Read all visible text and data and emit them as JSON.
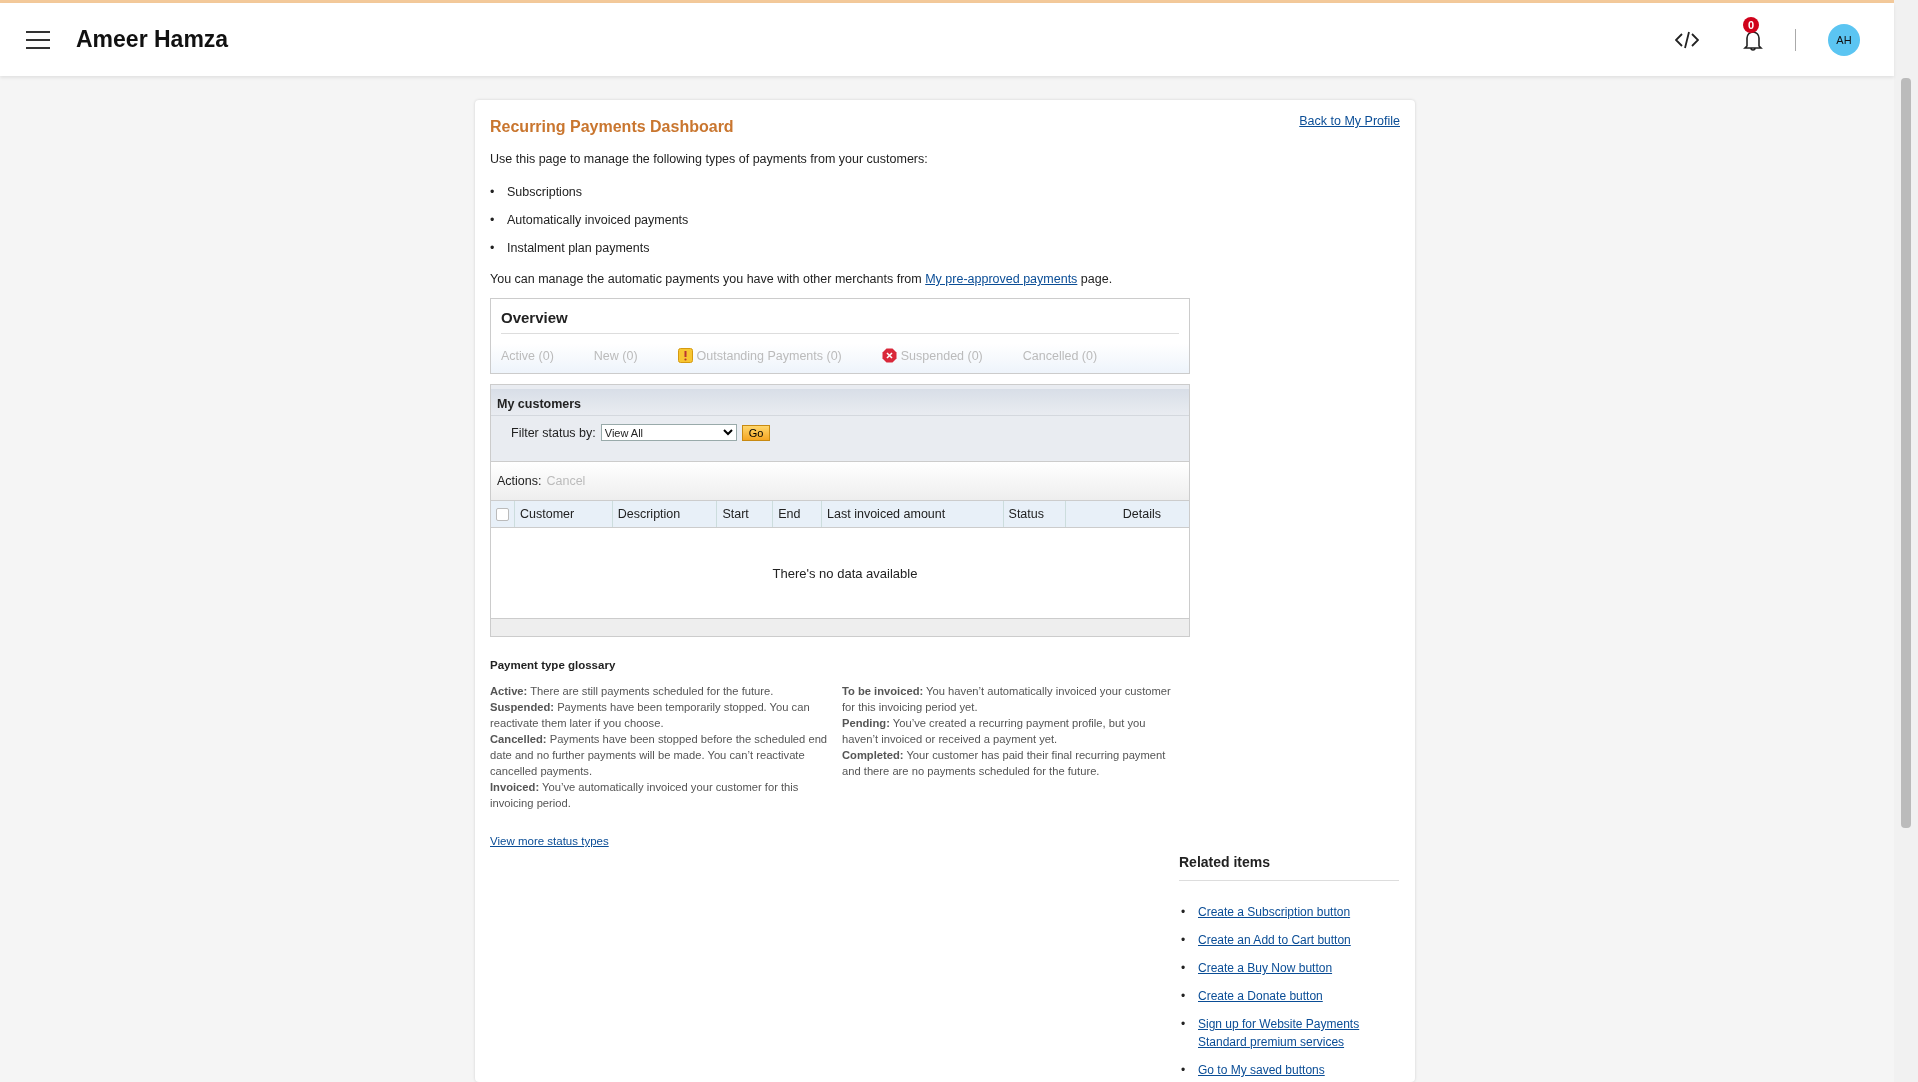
{
  "header": {
    "title": "Ameer Hamza",
    "notification_count": "0",
    "avatar": "AH"
  },
  "card": {
    "title": "Recurring Payments Dashboard",
    "back_link": "Back to My Profile",
    "intro": "Use this page to manage the following types of payments from your customers:",
    "bullet": "•",
    "types": [
      "Subscriptions",
      "Automatically invoiced payments",
      "Instalment plan payments"
    ],
    "manage_text": "You can manage the automatic payments you have with other merchants from",
    "manage_link": "My pre-approved payments",
    "manage_suffix": "page."
  },
  "overview": {
    "title": "Overview",
    "items": [
      {
        "label": "Active (0)",
        "kind": "plain",
        "disabled": true
      },
      {
        "label": "New (0)",
        "kind": "plain",
        "disabled": true
      },
      {
        "label": "Outstanding Payments (0)",
        "kind": "warning",
        "disabled": true
      },
      {
        "label": "Suspended (0)",
        "kind": "error",
        "disabled": true
      },
      {
        "label": "Cancelled (0)",
        "kind": "plain",
        "disabled": true
      }
    ]
  },
  "customers": {
    "title": "My customers",
    "filter_label": "Filter status by:",
    "filter_value": "View All",
    "go": "Go",
    "actions_label": "Actions:",
    "actions": [
      {
        "label": "Cancel",
        "disabled": true
      }
    ],
    "select_all_checked": false,
    "columns": [
      "Customer",
      "Description",
      "Start",
      "End",
      "Last invoiced amount",
      "Status",
      "Details"
    ],
    "empty": "There's no data available"
  },
  "glossary": {
    "title": "Payment type glossary",
    "columns": [
      [
        "**Active:**  There are still payments scheduled for the future.",
        "**Suspended:**  Payments have been temporarily stopped. You can reactivate them later if you choose.",
        "**Cancelled:**  Payments have been stopped before the scheduled end date and no further payments will be made. You can’t reactivate cancelled payments.",
        "**Invoiced:**  You’ve automatically invoiced your customer for this invoicing period."
      ],
      [
        "**To be invoiced:**  You haven’t automatically invoiced your customer for this invoicing period yet.",
        "**Pending:**  You’ve created a recurring payment profile, but you haven’t invoiced or received a payment yet.",
        "**Completed:**  Your customer has paid their final recurring payment and there are no payments scheduled for the future."
      ]
    ],
    "more_link": "View more status types"
  },
  "related": {
    "title": "Related items",
    "bullet": "•",
    "links": [
      "Create a Subscription button",
      "Create an Add to Cart button",
      "Create a Buy Now button",
      "Create a Donate button",
      "Sign up for Website Payments Standard premium services",
      "Go to My saved buttons"
    ]
  }
}
